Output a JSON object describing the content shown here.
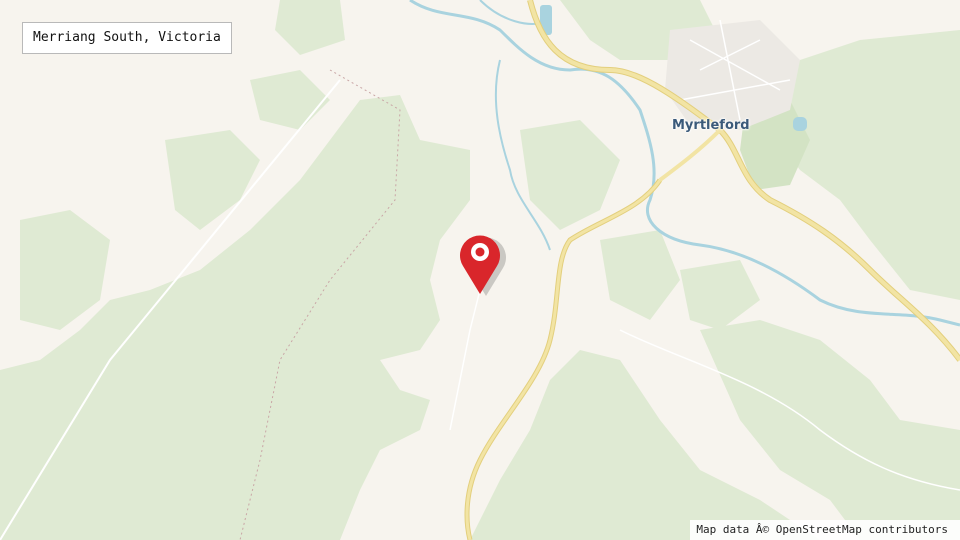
{
  "location_label": "Merriang South, Victoria",
  "town_label": "Myrtleford",
  "attribution": "Map data Â© OpenStreetMap contributors",
  "marker_icon": "map-pin-icon",
  "colors": {
    "land": "#f7f4ee",
    "forest": "#dfead3",
    "forest_dark": "#d3e3c4",
    "water": "#a9d3df",
    "road_major": "#f2e4a4",
    "road_major_edge": "#e3cf7d",
    "road_minor": "#ffffff",
    "town_area": "#ece9e4",
    "marker": "#d9262b",
    "town_label": "#3b5a7a"
  }
}
